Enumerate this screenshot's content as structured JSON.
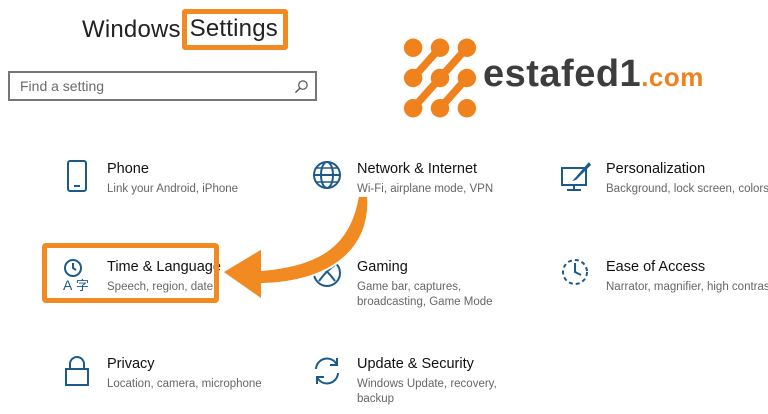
{
  "header": {
    "title_part1": "Windows",
    "title_part2": "Settings"
  },
  "search": {
    "placeholder": "Find a setting",
    "icon": "search-icon"
  },
  "logo": {
    "name": "estafed1",
    "tld": ".com",
    "brand_color": "#f0821e"
  },
  "accent_color": "#f28a22",
  "tiles": [
    {
      "title": "Phone",
      "desc": "Link your Android, iPhone",
      "icon": "phone-icon"
    },
    {
      "title": "Network & Internet",
      "desc": "Wi-Fi, airplane mode, VPN",
      "icon": "globe-icon"
    },
    {
      "title": "Personalization",
      "desc": "Background, lock screen, colors",
      "icon": "paint-icon"
    },
    {
      "title": "Time & Language",
      "desc": "Speech, region, date",
      "icon": "time-language-icon"
    },
    {
      "title": "Gaming",
      "desc": "Game bar, captures, broadcasting, Game Mode",
      "icon": "xbox-icon"
    },
    {
      "title": "Ease of Access",
      "desc": "Narrator, magnifier, high contrast",
      "icon": "ease-of-access-icon"
    },
    {
      "title": "Privacy",
      "desc": "Location, camera, microphone",
      "icon": "lock-icon"
    },
    {
      "title": "Update & Security",
      "desc": "Windows Update, recovery, backup",
      "icon": "sync-icon"
    }
  ]
}
